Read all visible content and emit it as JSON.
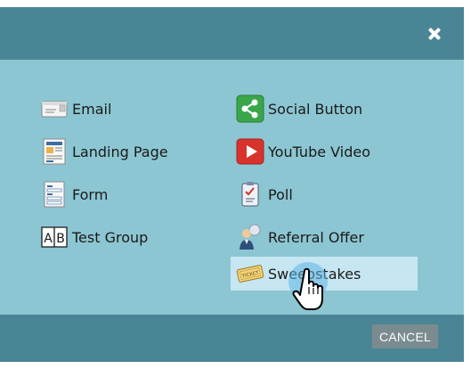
{
  "dialog": {
    "close_symbol": "✕",
    "cancel_label": "CANCEL"
  },
  "items": {
    "email": {
      "label": "Email",
      "icon": "email-icon"
    },
    "landing_page": {
      "label": "Landing Page",
      "icon": "landing-page-icon"
    },
    "form": {
      "label": "Form",
      "icon": "form-icon"
    },
    "test_group": {
      "label": "Test Group",
      "icon": "test-group-icon",
      "icon_text": "A|B"
    },
    "social_button": {
      "label": "Social Button",
      "icon": "share-icon"
    },
    "youtube_video": {
      "label": "YouTube Video",
      "icon": "youtube-icon"
    },
    "poll": {
      "label": "Poll",
      "icon": "poll-icon"
    },
    "referral_offer": {
      "label": "Referral Offer",
      "icon": "referral-icon"
    },
    "sweepstakes": {
      "label": "Sweepstakes",
      "icon": "ticket-icon",
      "icon_text": "TICKET",
      "state": "hovered"
    }
  },
  "colors": {
    "header": "#4a8595",
    "body": "#8cc6d2",
    "hover_row": "#c6e6f1",
    "cancel_button": "#7a8c90"
  }
}
